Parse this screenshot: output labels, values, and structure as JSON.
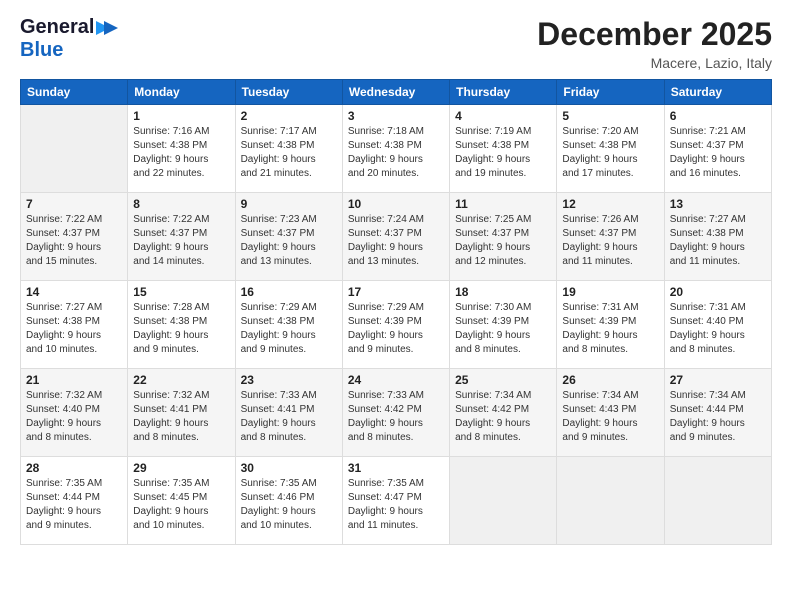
{
  "logo": {
    "line1": "General",
    "line2": "Blue",
    "icon": "▶"
  },
  "title": "December 2025",
  "subtitle": "Macere, Lazio, Italy",
  "headers": [
    "Sunday",
    "Monday",
    "Tuesday",
    "Wednesday",
    "Thursday",
    "Friday",
    "Saturday"
  ],
  "weeks": [
    [
      {
        "day": "",
        "info": ""
      },
      {
        "day": "1",
        "info": "Sunrise: 7:16 AM\nSunset: 4:38 PM\nDaylight: 9 hours\nand 22 minutes."
      },
      {
        "day": "2",
        "info": "Sunrise: 7:17 AM\nSunset: 4:38 PM\nDaylight: 9 hours\nand 21 minutes."
      },
      {
        "day": "3",
        "info": "Sunrise: 7:18 AM\nSunset: 4:38 PM\nDaylight: 9 hours\nand 20 minutes."
      },
      {
        "day": "4",
        "info": "Sunrise: 7:19 AM\nSunset: 4:38 PM\nDaylight: 9 hours\nand 19 minutes."
      },
      {
        "day": "5",
        "info": "Sunrise: 7:20 AM\nSunset: 4:38 PM\nDaylight: 9 hours\nand 17 minutes."
      },
      {
        "day": "6",
        "info": "Sunrise: 7:21 AM\nSunset: 4:37 PM\nDaylight: 9 hours\nand 16 minutes."
      }
    ],
    [
      {
        "day": "7",
        "info": "Sunrise: 7:22 AM\nSunset: 4:37 PM\nDaylight: 9 hours\nand 15 minutes."
      },
      {
        "day": "8",
        "info": "Sunrise: 7:22 AM\nSunset: 4:37 PM\nDaylight: 9 hours\nand 14 minutes."
      },
      {
        "day": "9",
        "info": "Sunrise: 7:23 AM\nSunset: 4:37 PM\nDaylight: 9 hours\nand 13 minutes."
      },
      {
        "day": "10",
        "info": "Sunrise: 7:24 AM\nSunset: 4:37 PM\nDaylight: 9 hours\nand 13 minutes."
      },
      {
        "day": "11",
        "info": "Sunrise: 7:25 AM\nSunset: 4:37 PM\nDaylight: 9 hours\nand 12 minutes."
      },
      {
        "day": "12",
        "info": "Sunrise: 7:26 AM\nSunset: 4:37 PM\nDaylight: 9 hours\nand 11 minutes."
      },
      {
        "day": "13",
        "info": "Sunrise: 7:27 AM\nSunset: 4:38 PM\nDaylight: 9 hours\nand 11 minutes."
      }
    ],
    [
      {
        "day": "14",
        "info": "Sunrise: 7:27 AM\nSunset: 4:38 PM\nDaylight: 9 hours\nand 10 minutes."
      },
      {
        "day": "15",
        "info": "Sunrise: 7:28 AM\nSunset: 4:38 PM\nDaylight: 9 hours\nand 9 minutes."
      },
      {
        "day": "16",
        "info": "Sunrise: 7:29 AM\nSunset: 4:38 PM\nDaylight: 9 hours\nand 9 minutes."
      },
      {
        "day": "17",
        "info": "Sunrise: 7:29 AM\nSunset: 4:39 PM\nDaylight: 9 hours\nand 9 minutes."
      },
      {
        "day": "18",
        "info": "Sunrise: 7:30 AM\nSunset: 4:39 PM\nDaylight: 9 hours\nand 8 minutes."
      },
      {
        "day": "19",
        "info": "Sunrise: 7:31 AM\nSunset: 4:39 PM\nDaylight: 9 hours\nand 8 minutes."
      },
      {
        "day": "20",
        "info": "Sunrise: 7:31 AM\nSunset: 4:40 PM\nDaylight: 9 hours\nand 8 minutes."
      }
    ],
    [
      {
        "day": "21",
        "info": "Sunrise: 7:32 AM\nSunset: 4:40 PM\nDaylight: 9 hours\nand 8 minutes."
      },
      {
        "day": "22",
        "info": "Sunrise: 7:32 AM\nSunset: 4:41 PM\nDaylight: 9 hours\nand 8 minutes."
      },
      {
        "day": "23",
        "info": "Sunrise: 7:33 AM\nSunset: 4:41 PM\nDaylight: 9 hours\nand 8 minutes."
      },
      {
        "day": "24",
        "info": "Sunrise: 7:33 AM\nSunset: 4:42 PM\nDaylight: 9 hours\nand 8 minutes."
      },
      {
        "day": "25",
        "info": "Sunrise: 7:34 AM\nSunset: 4:42 PM\nDaylight: 9 hours\nand 8 minutes."
      },
      {
        "day": "26",
        "info": "Sunrise: 7:34 AM\nSunset: 4:43 PM\nDaylight: 9 hours\nand 9 minutes."
      },
      {
        "day": "27",
        "info": "Sunrise: 7:34 AM\nSunset: 4:44 PM\nDaylight: 9 hours\nand 9 minutes."
      }
    ],
    [
      {
        "day": "28",
        "info": "Sunrise: 7:35 AM\nSunset: 4:44 PM\nDaylight: 9 hours\nand 9 minutes."
      },
      {
        "day": "29",
        "info": "Sunrise: 7:35 AM\nSunset: 4:45 PM\nDaylight: 9 hours\nand 10 minutes."
      },
      {
        "day": "30",
        "info": "Sunrise: 7:35 AM\nSunset: 4:46 PM\nDaylight: 9 hours\nand 10 minutes."
      },
      {
        "day": "31",
        "info": "Sunrise: 7:35 AM\nSunset: 4:47 PM\nDaylight: 9 hours\nand 11 minutes."
      },
      {
        "day": "",
        "info": ""
      },
      {
        "day": "",
        "info": ""
      },
      {
        "day": "",
        "info": ""
      }
    ]
  ]
}
